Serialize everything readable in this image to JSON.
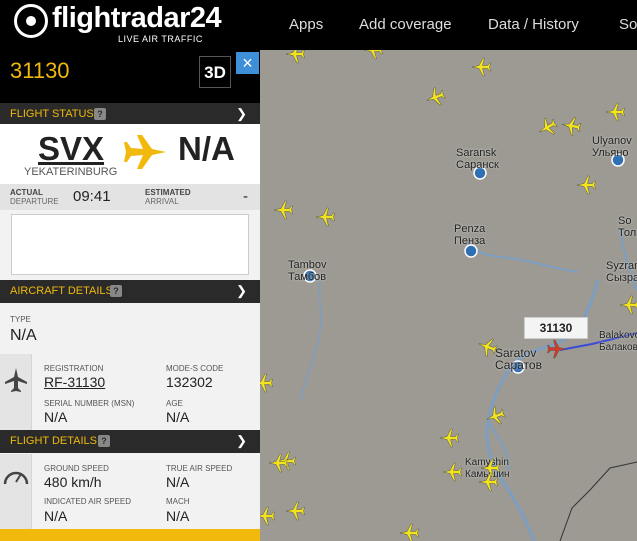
{
  "header": {
    "logo_text": "flightradar",
    "logo_number": "24",
    "logo_sub": "LIVE AIR TRAFFIC",
    "nav": [
      "Apps",
      "Add coverage",
      "Data / History",
      "So"
    ]
  },
  "panel": {
    "callsign": "31130",
    "view_3d_label": "3D",
    "close_icon": "×",
    "sections": {
      "flight_status": "FLIGHT STATUS",
      "aircraft_details": "AIRCRAFT DETAILS",
      "flight_details": "FLIGHT DETAILS",
      "help_icon": "?"
    },
    "route": {
      "origin": "SVX",
      "origin_city": "YEKATERINBURG",
      "destination": "N/A"
    },
    "times": {
      "actual_label": "ACTUAL",
      "departure_label": "DEPARTURE",
      "departure_time": "09:41",
      "estimated_label": "ESTIMATED",
      "arrival_label": "ARRIVAL",
      "arrival_time": "-"
    },
    "aircraft": {
      "type_label": "TYPE",
      "type_value": "N/A",
      "registration_label": "REGISTRATION",
      "registration_value": "RF-31130",
      "modes_label": "MODE-S CODE",
      "modes_value": "132302",
      "serial_label": "SERIAL NUMBER (MSN)",
      "serial_value": "N/A",
      "age_label": "AGE",
      "age_value": "N/A"
    },
    "flight_details": {
      "ground_speed_label": "GROUND SPEED",
      "ground_speed_value": "480 km/h",
      "true_airspeed_label": "TRUE AIR SPEED",
      "true_airspeed_value": "N/A",
      "indicated_airspeed_label": "INDICATED AIR SPEED",
      "indicated_airspeed_value": "N/A",
      "mach_label": "MACH",
      "mach_value": "N/A"
    }
  },
  "map": {
    "cities": [
      {
        "name": "Saransk",
        "name2": "Саранск"
      },
      {
        "name": "Ulyanov",
        "name2": "Ульяно"
      },
      {
        "name": "Penza",
        "name2": "Пенза"
      },
      {
        "name": "Tambov",
        "name2": "Тамбов"
      },
      {
        "name": "Saratov",
        "name2": "Саратов"
      },
      {
        "name": "Kamyshin",
        "name2": "Камышин"
      },
      {
        "name": "So",
        "name2": "Толь"
      },
      {
        "name": "Syzran",
        "name2": "Сызра"
      },
      {
        "name": "Balakovo",
        "name2": "Балаков"
      }
    ],
    "selected_label": "31130",
    "colors": {
      "land": "#9c9a92",
      "water": "#7d9ec3",
      "plane": "#f2e31c",
      "selected_plane": "#d23b2a",
      "track": "#3b4bd4",
      "accent": "#f0b90b"
    }
  }
}
